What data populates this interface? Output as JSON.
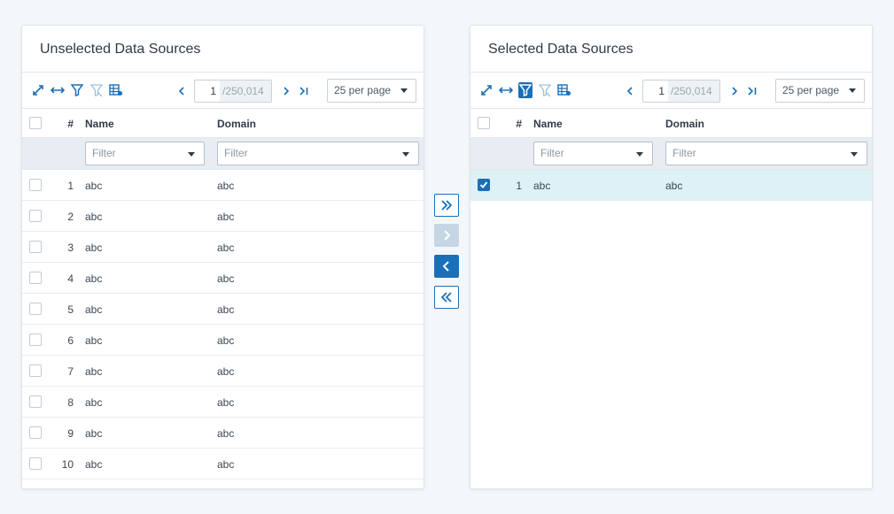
{
  "colors": {
    "accent": "#1a6fb8",
    "selected_row": "#ddf1f6",
    "filter_row": "#e7edf2",
    "disabled": "#c6d6e4"
  },
  "left": {
    "title": "Unselected Data Sources",
    "toolbar": {
      "icons": [
        "expand-icon",
        "fit-columns-icon",
        "filter-icon",
        "clear-filter-icon",
        "grid-settings-icon"
      ],
      "page_current": "1",
      "page_total": "/250,014",
      "per_page": "25 per page"
    },
    "columns": {
      "num": "#",
      "name": "Name",
      "domain": "Domain"
    },
    "filter_placeholder_name": "Filter",
    "filter_placeholder_domain": "Filter",
    "rows": [
      {
        "num": "1",
        "name": "abc",
        "domain": "abc"
      },
      {
        "num": "2",
        "name": "abc",
        "domain": "abc"
      },
      {
        "num": "3",
        "name": "abc",
        "domain": "abc"
      },
      {
        "num": "4",
        "name": "abc",
        "domain": "abc"
      },
      {
        "num": "5",
        "name": "abc",
        "domain": "abc"
      },
      {
        "num": "6",
        "name": "abc",
        "domain": "abc"
      },
      {
        "num": "7",
        "name": "abc",
        "domain": "abc"
      },
      {
        "num": "8",
        "name": "abc",
        "domain": "abc"
      },
      {
        "num": "9",
        "name": "abc",
        "domain": "abc"
      },
      {
        "num": "10",
        "name": "abc",
        "domain": "abc"
      }
    ]
  },
  "right": {
    "title": "Selected Data Sources",
    "toolbar": {
      "icons": [
        "expand-icon",
        "fit-columns-icon",
        "filter-icon-active",
        "clear-filter-icon",
        "grid-settings-icon"
      ],
      "page_current": "1",
      "page_total": "/250,014",
      "per_page": "25 per page"
    },
    "columns": {
      "num": "#",
      "name": "Name",
      "domain": "Domain"
    },
    "filter_placeholder_name": "Filter",
    "filter_placeholder_domain": "Filter",
    "rows": [
      {
        "num": "1",
        "name": "abc",
        "domain": "abc",
        "checked": true
      }
    ]
  },
  "transfer_buttons": [
    {
      "name": "move-all-right-button",
      "icon": "double-chevron-right-icon",
      "state": "enabled"
    },
    {
      "name": "move-right-button",
      "icon": "chevron-right-icon",
      "state": "disabled"
    },
    {
      "name": "move-left-button",
      "icon": "chevron-left-icon",
      "state": "primary"
    },
    {
      "name": "move-all-left-button",
      "icon": "double-chevron-left-icon",
      "state": "enabled"
    }
  ]
}
